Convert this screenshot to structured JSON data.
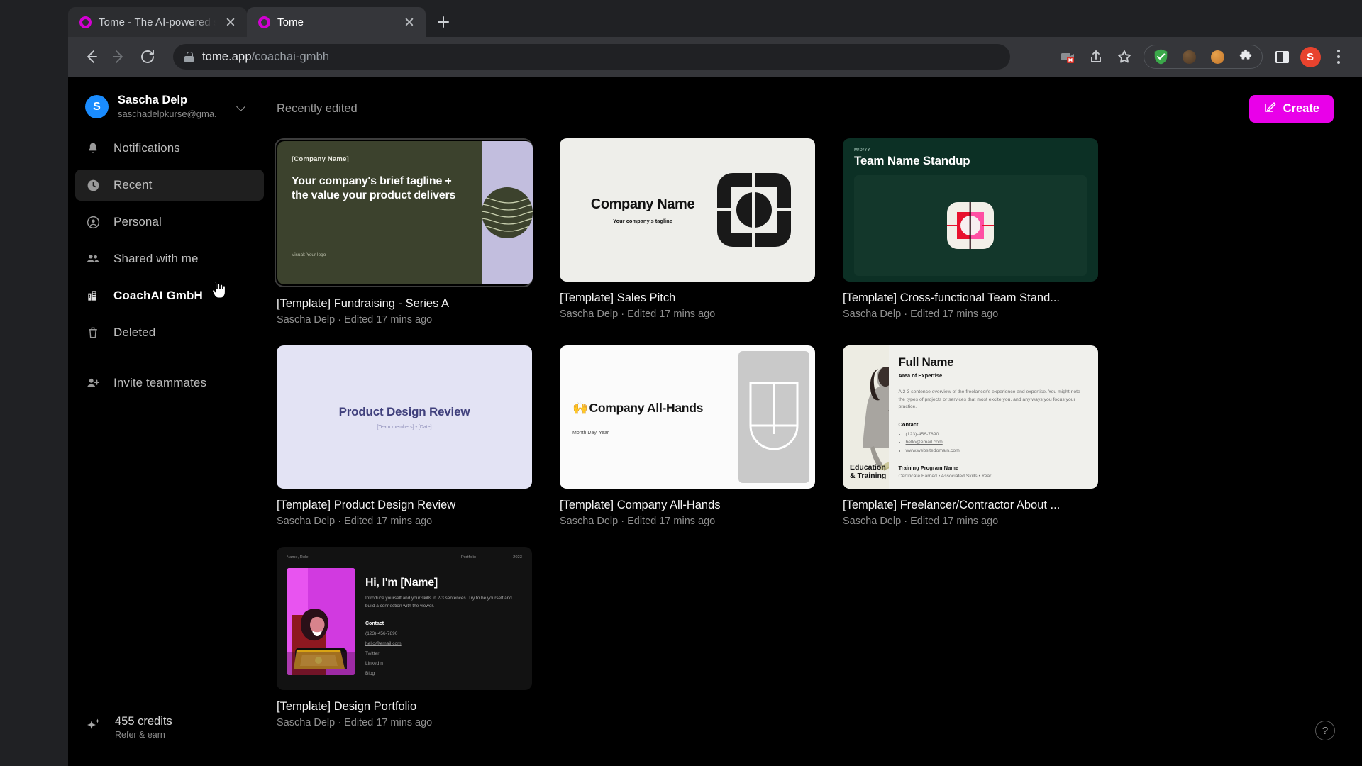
{
  "browser": {
    "tabs": [
      {
        "title": "Tome - The AI-powered storyte",
        "favicon": "tome-logo-icon",
        "active": false
      },
      {
        "title": "Tome",
        "favicon": "tome-logo-icon",
        "active": true
      }
    ],
    "new_tab_label": "+",
    "url_domain": "tome.app",
    "url_path": "/coachai-gmbh",
    "profile_initial": "S",
    "toolbar_icons": [
      "back-icon",
      "forward-icon",
      "reload-icon",
      "lock-icon",
      "media-cast-blocked-icon",
      "share-icon",
      "bookmark-star-icon",
      "adblock-shield-icon",
      "cookie-dark-icon",
      "cookie-light-icon",
      "extensions-puzzle-icon",
      "side-panel-icon",
      "profile-avatar",
      "chrome-menu-icon"
    ]
  },
  "sidebar": {
    "account": {
      "initial": "S",
      "name": "Sascha Delp",
      "email": "saschadelpkurse@gma.",
      "chevron": "chevron-down-icon"
    },
    "items": [
      {
        "label": "Notifications",
        "icon": "bell-icon",
        "active": false,
        "strong": false
      },
      {
        "label": "Recent",
        "icon": "clock-icon",
        "active": true,
        "strong": false
      },
      {
        "label": "Personal",
        "icon": "person-circle-icon",
        "active": false,
        "strong": false
      },
      {
        "label": "Shared with me",
        "icon": "people-icon",
        "active": false,
        "strong": false
      },
      {
        "label": "CoachAI GmbH",
        "icon": "building-icon",
        "active": false,
        "strong": true
      },
      {
        "label": "Deleted",
        "icon": "trash-icon",
        "active": false,
        "strong": false
      }
    ],
    "invite": {
      "label": "Invite teammates",
      "icon": "person-add-icon"
    },
    "credits": {
      "amount": "455 credits",
      "sub": "Refer & earn",
      "icon": "sparkle-icon"
    }
  },
  "main": {
    "section_title": "Recently edited",
    "create_button": {
      "label": "Create",
      "icon": "pencil-square-icon"
    },
    "help_button": {
      "label": "?",
      "icon": "help-circle-icon"
    },
    "cards": [
      {
        "title": "[Template] Fundraising - Series A",
        "meta": "Sascha Delp · Edited 17 mins ago",
        "selected": true,
        "thumb": {
          "kind": "fundraising",
          "company": "[Company Name]",
          "headline": "Your company's brief tagline + the value your product delivers",
          "footnote": "Visual: Your logo"
        }
      },
      {
        "title": "[Template] Sales Pitch",
        "meta": "Sascha Delp · Edited 17 mins ago",
        "selected": false,
        "thumb": {
          "kind": "sales",
          "company": "Company Name",
          "tagline": "Your company's tagline"
        }
      },
      {
        "title": "[Template] Cross-functional Team Stand...",
        "meta": "Sascha Delp · Edited 17 mins ago",
        "selected": false,
        "thumb": {
          "kind": "standup",
          "date": "M/D/YY",
          "headline": "Team Name Standup"
        }
      },
      {
        "title": "[Template] Product Design Review",
        "meta": "Sascha Delp · Edited 17 mins ago",
        "selected": false,
        "thumb": {
          "kind": "design-review",
          "headline": "Product Design Review",
          "sub": "[Team members] • [Date]"
        }
      },
      {
        "title": "[Template] Company All-Hands",
        "meta": "Sascha Delp · Edited 17 mins ago",
        "selected": false,
        "thumb": {
          "kind": "all-hands",
          "emoji": "🙌",
          "headline": "Company All-Hands",
          "date": "Month Day, Year"
        }
      },
      {
        "title": "[Template] Freelancer/Contractor About ...",
        "meta": "Sascha Delp · Edited 17 mins ago",
        "selected": false,
        "thumb": {
          "kind": "freelancer",
          "name": "Full Name",
          "area": "Area of Expertise",
          "paragraph": "A 2-3 sentence overview of the freelancer's experience and expertise. You might note the types of projects or services that most excite you, and any ways you focus your practice.",
          "contact_heading": "Contact",
          "contact_items": [
            "(123)-456-7890",
            "hello@email.com",
            "www.websitedomain.com"
          ],
          "education_label": "Education & Training",
          "program_name": "Training Program Name",
          "certificate": "Certificate Earned • Associated Skills • Year"
        }
      },
      {
        "title": "[Template] Design Portfolio",
        "meta": "Sascha Delp · Edited 17 mins ago",
        "selected": false,
        "thumb": {
          "kind": "portfolio",
          "bar_left": "Name, Role",
          "bar_mid": "Portfolio",
          "bar_right": "2023",
          "headline": "Hi, I'm [Name]",
          "paragraph": "Introduce yourself and your skills in 2-3 sentences. Try to be yourself and build a connection with the viewer.",
          "contact_heading": "Contact",
          "contact_items": [
            "(123)-456-7890",
            "hello@email.com",
            "Twitter",
            "LinkedIn",
            "Blog"
          ]
        }
      }
    ]
  },
  "colors": {
    "brand_magenta": "#e900e9",
    "accent_blue": "#1a8cff",
    "app_background": "#000000",
    "chrome_toolbar": "#35363a"
  }
}
